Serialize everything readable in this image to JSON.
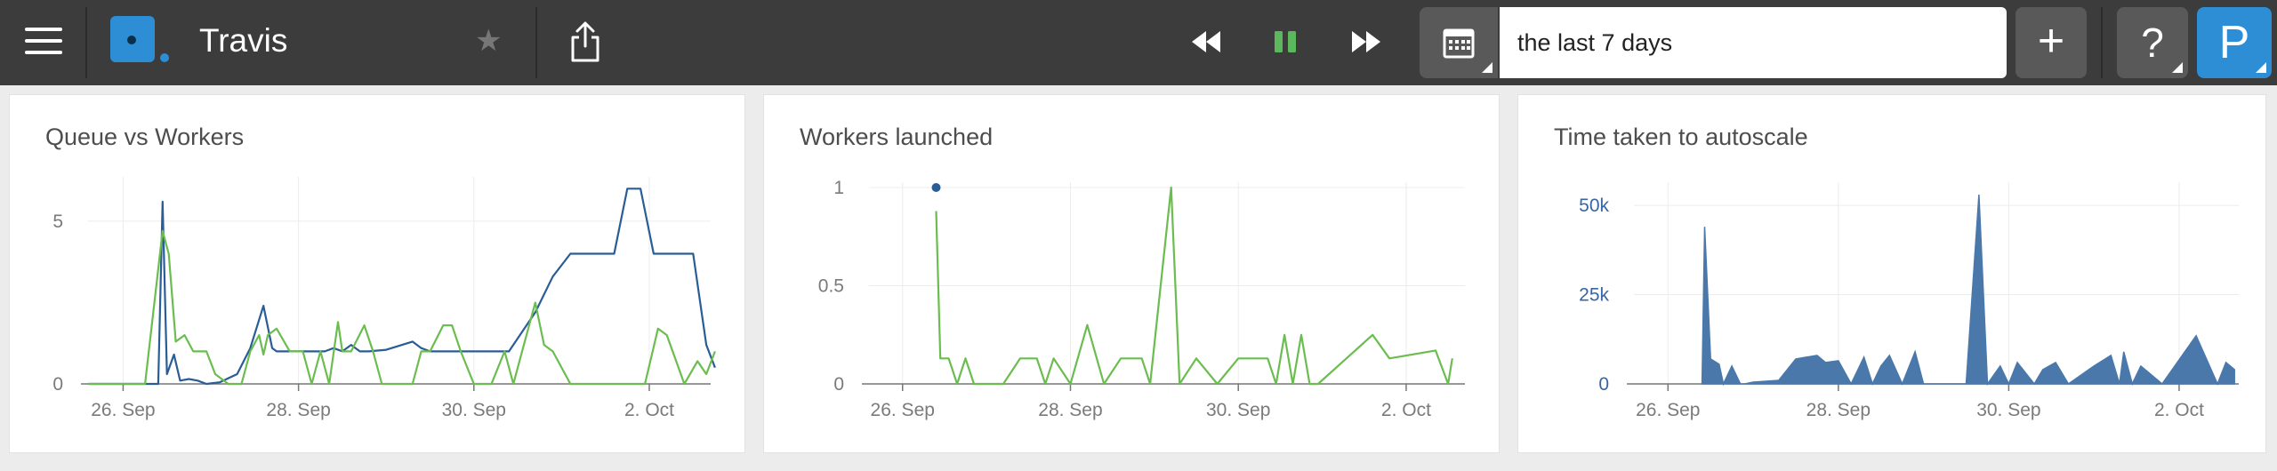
{
  "topbar": {
    "menu_icon": "hamburger-menu-icon",
    "logo_icon": "grafana-style-logo-icon",
    "dashboard_title": "Travis",
    "star_icon": "star-icon",
    "share_icon": "share-icon",
    "rewind_icon": "rewind-icon",
    "pause_icon": "pause-icon",
    "fast_forward_icon": "fast-forward-icon",
    "calendar_icon": "calendar-icon",
    "time_range": "the last 7 days",
    "add_label": "+",
    "help_label": "?",
    "user_label": "P",
    "colors": {
      "bar": "#3c3c3c",
      "button": "#595959",
      "accent": "#2d8ed6",
      "pause": "#5cb85c"
    }
  },
  "panels": [
    {
      "title": "Queue vs Workers"
    },
    {
      "title": "Workers launched"
    },
    {
      "title": "Time taken to autoscale"
    }
  ],
  "chart_data": [
    {
      "type": "line",
      "title": "Queue vs Workers",
      "x_ticks": [
        "26. Sep",
        "28. Sep",
        "30. Sep",
        "2. Oct"
      ],
      "y_ticks": [
        "0",
        "5"
      ],
      "ylim": [
        0,
        6.2
      ],
      "xlim": [
        25.6,
        32.7
      ],
      "grid": true,
      "series": [
        {
          "color": "#2a5d96",
          "x": [
            25.6,
            26.2,
            26.4,
            26.45,
            26.5,
            26.58,
            26.65,
            26.75,
            26.85,
            26.95,
            27.1,
            27.3,
            27.45,
            27.6,
            27.7,
            27.75,
            27.9,
            28.1,
            28.3,
            28.4,
            28.5,
            28.6,
            28.7,
            28.8,
            29.0,
            29.3,
            29.4,
            29.5,
            29.7,
            29.9,
            30.1,
            30.4,
            30.7,
            30.9,
            31.1,
            31.2,
            31.35,
            31.6,
            31.75,
            31.9,
            32.05,
            32.3,
            32.5,
            32.65,
            32.75
          ],
          "y": [
            0,
            0,
            0,
            5.6,
            0.3,
            0.9,
            0.1,
            0.15,
            0.1,
            0.0,
            0.05,
            0.3,
            1.1,
            2.4,
            1.1,
            1.0,
            1.0,
            1.0,
            1.0,
            1.1,
            1.0,
            1.2,
            1.0,
            1.0,
            1.05,
            1.3,
            1.1,
            1.0,
            1.0,
            1.0,
            1.0,
            1.0,
            2.2,
            3.3,
            4.0,
            4.0,
            4.0,
            4.0,
            6.0,
            6.0,
            4.0,
            4.0,
            4.0,
            1.2,
            0.5
          ]
        },
        {
          "color": "#6abd4e",
          "x": [
            25.6,
            26.25,
            26.45,
            26.52,
            26.6,
            26.7,
            26.8,
            26.95,
            27.05,
            27.2,
            27.35,
            27.45,
            27.55,
            27.6,
            27.65,
            27.75,
            27.9,
            28.05,
            28.15,
            28.25,
            28.35,
            28.45,
            28.5,
            28.6,
            28.75,
            28.85,
            28.95,
            29.05,
            29.3,
            29.4,
            29.5,
            29.65,
            29.75,
            29.85,
            30.0,
            30.2,
            30.35,
            30.45,
            30.55,
            30.7,
            30.8,
            30.9,
            31.1,
            31.3,
            31.45,
            31.6,
            31.75,
            31.95,
            32.1,
            32.2,
            32.4,
            32.55,
            32.65,
            32.75
          ],
          "y": [
            0,
            0,
            4.7,
            4.0,
            1.3,
            1.5,
            1.0,
            1.0,
            0.3,
            0.0,
            0.0,
            1.0,
            1.5,
            0.9,
            1.5,
            1.7,
            1.0,
            1.0,
            0.0,
            1.0,
            0.0,
            1.9,
            1.0,
            1.0,
            1.8,
            1.0,
            0.0,
            0.0,
            0.0,
            1.0,
            1.0,
            1.8,
            1.8,
            1.0,
            0.0,
            0.0,
            1.0,
            0.0,
            1.0,
            2.5,
            1.2,
            1.0,
            0.0,
            0.0,
            0.0,
            0.0,
            0.0,
            0.0,
            1.7,
            1.5,
            0.0,
            0.7,
            0.3,
            1.0
          ]
        }
      ]
    },
    {
      "type": "line",
      "title": "Workers launched",
      "x_ticks": [
        "26. Sep",
        "28. Sep",
        "30. Sep",
        "2. Oct"
      ],
      "y_ticks": [
        "0",
        "0.5",
        "1"
      ],
      "ylim": [
        0,
        1
      ],
      "xlim": [
        25.6,
        32.7
      ],
      "grid": true,
      "marker": {
        "x": 26.4,
        "y": 1.0,
        "color": "#2a5d96"
      },
      "series": [
        {
          "color": "#6abd4e",
          "x": [
            26.4,
            26.45,
            26.55,
            26.65,
            26.75,
            26.85,
            27.0,
            27.2,
            27.4,
            27.55,
            27.6,
            27.7,
            27.8,
            28.0,
            28.2,
            28.4,
            28.6,
            28.7,
            28.85,
            28.95,
            29.2,
            29.3,
            29.5,
            29.75,
            30.0,
            30.35,
            30.45,
            30.55,
            30.65,
            30.75,
            30.85,
            30.95,
            31.6,
            31.8,
            32.35,
            32.5,
            32.55
          ],
          "y": [
            0.88,
            0.13,
            0.13,
            0.0,
            0.13,
            0.0,
            0.0,
            0.0,
            0.13,
            0.13,
            0.13,
            0.0,
            0.13,
            0.0,
            0.3,
            0.0,
            0.13,
            0.13,
            0.13,
            0.0,
            1.0,
            0.0,
            0.13,
            0.0,
            0.13,
            0.13,
            0.0,
            0.25,
            0.0,
            0.25,
            0.0,
            0.0,
            0.25,
            0.13,
            0.17,
            0.0,
            0.13
          ]
        }
      ]
    },
    {
      "type": "area",
      "title": "Time taken to autoscale",
      "x_ticks": [
        "26. Sep",
        "28. Sep",
        "30. Sep",
        "2. Oct"
      ],
      "y_ticks": [
        "0",
        "25k",
        "50k"
      ],
      "ylim": [
        0,
        55000
      ],
      "xlim": [
        25.6,
        32.7
      ],
      "grid": true,
      "series": [
        {
          "color": "#4a78ab",
          "x": [
            26.4,
            26.43,
            26.5,
            26.6,
            26.65,
            26.75,
            26.85,
            26.9,
            27.0,
            27.3,
            27.5,
            27.75,
            27.85,
            28.0,
            28.15,
            28.3,
            28.4,
            28.5,
            28.6,
            28.75,
            28.9,
            29.0,
            29.2,
            29.5,
            29.65,
            29.75,
            29.9,
            30.0,
            30.1,
            30.3,
            30.4,
            30.55,
            30.7,
            31.0,
            31.2,
            31.3,
            31.35,
            31.45,
            31.55,
            31.8,
            32.2,
            32.45,
            32.55,
            32.65
          ],
          "y": [
            0,
            44000,
            7000,
            5500,
            0,
            5000,
            0,
            0,
            500,
            1000,
            7000,
            8000,
            6000,
            6500,
            0,
            7500,
            0,
            5000,
            8000,
            0,
            9000,
            0,
            0,
            0,
            53000,
            0,
            5000,
            0,
            6000,
            0,
            4000,
            6000,
            0,
            5000,
            8000,
            0,
            9000,
            0,
            5000,
            0,
            13500,
            0,
            6000,
            4000
          ]
        }
      ]
    }
  ]
}
